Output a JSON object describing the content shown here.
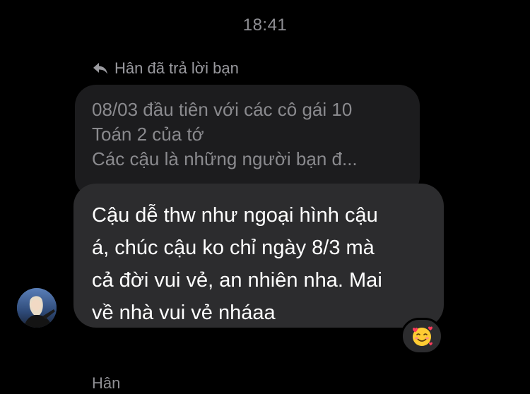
{
  "conversation": {
    "timestamp": "18:41",
    "reply_indicator": {
      "icon": "reply-arrow-icon",
      "text": "Hân đã trả lời bạn"
    },
    "quoted_message": {
      "lines": [
        "08/03 đầu tiên với các cô gái 10",
        "Toán 2 của tớ",
        "Các cậu là những người bạn đ..."
      ]
    },
    "message": {
      "lines": [
        "Cậu dễ thw như ngoại hình cậu",
        "á, chúc cậu ko chỉ ngày 8/3 mà",
        "cả đời vui vẻ, an nhiên nha. Mai",
        "về nhà vui vẻ nháaa"
      ],
      "reaction": "smiling-face-with-hearts-icon"
    },
    "sender": {
      "name": "Hân",
      "avatar": "avatar-photo"
    }
  },
  "colors": {
    "background": "#000000",
    "quoted_bubble": "#1c1c1e",
    "message_bubble": "#2c2c2e",
    "secondary_text": "#8e8e93",
    "quoted_text": "#8a8a8e"
  }
}
